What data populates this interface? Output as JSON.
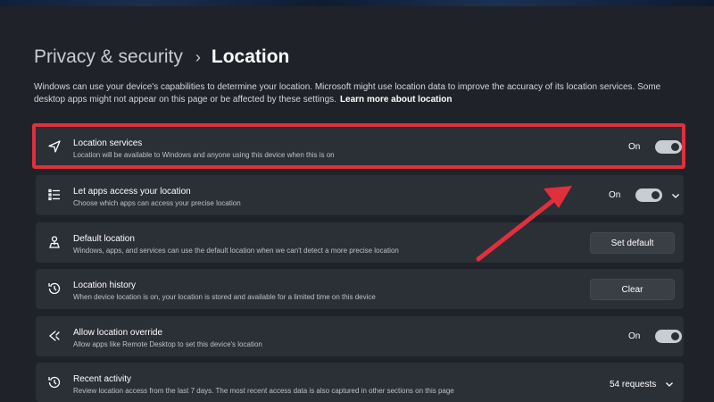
{
  "breadcrumb": {
    "parent": "Privacy & security",
    "separator": "›",
    "current": "Location"
  },
  "description": {
    "text": "Windows can use your device's capabilities to determine your location. Microsoft might use location data to improve the accuracy of its location services. Some desktop apps might not appear on this page or be affected by these settings.",
    "link": "Learn more about location"
  },
  "settings": [
    {
      "icon": "location-arrow-icon",
      "title": "Location services",
      "subtitle": "Location will be available to Windows and anyone using this device when this is on",
      "toggle_label": "On",
      "toggle_on": true
    },
    {
      "icon": "app-list-icon",
      "title": "Let apps access your location",
      "subtitle": "Choose which apps can access your precise location",
      "toggle_label": "On",
      "toggle_on": true
    },
    {
      "icon": "person-pin-icon",
      "title": "Default location",
      "subtitle": "Windows, apps, and services can use the default location when we can't detect a more precise location",
      "button_label": "Set default"
    },
    {
      "icon": "history-icon",
      "title": "Location history",
      "subtitle": "When device location is on, your location is stored and available for a limited time on this device",
      "button_label": "Clear"
    },
    {
      "icon": "override-arrows-icon",
      "title": "Allow location override",
      "subtitle": "Allow apps like Remote Desktop to set this device's location",
      "toggle_label": "On",
      "toggle_on": true
    },
    {
      "icon": "history-icon",
      "title": "Recent activity",
      "subtitle": "Review location access from the last 7 days. The most recent access data is also captured in other sections on this page",
      "requests_label": "54 requests"
    }
  ],
  "colors": {
    "background": "#1f2329",
    "card": "#2b2f36",
    "highlight": "#e0303c",
    "toggle": "#c9ccd0"
  }
}
